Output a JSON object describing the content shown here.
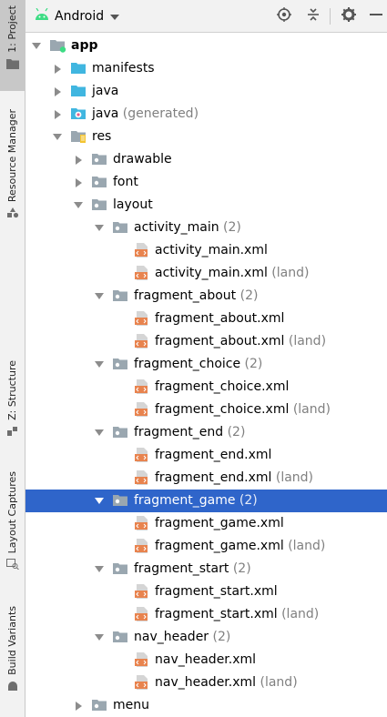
{
  "header": {
    "project_view": "Android",
    "tools": [
      "locate-icon",
      "collapse-all-icon",
      "gear-icon",
      "minimize-icon"
    ]
  },
  "sidebar": {
    "tabs": [
      {
        "label": "1: Project",
        "active": true
      },
      {
        "label": "Resource Manager",
        "active": false
      },
      {
        "label": "Z: Structure",
        "active": false
      },
      {
        "label": "Layout Captures",
        "active": false
      },
      {
        "label": "Build Variants",
        "active": false
      }
    ]
  },
  "tree": [
    {
      "depth": 0,
      "arrow": "down",
      "icon": "module",
      "label": "app",
      "hint": "",
      "bold": true
    },
    {
      "depth": 1,
      "arrow": "right",
      "icon": "folder-blue",
      "label": "manifests",
      "hint": ""
    },
    {
      "depth": 1,
      "arrow": "right",
      "icon": "folder-blue",
      "label": "java",
      "hint": ""
    },
    {
      "depth": 1,
      "arrow": "right",
      "icon": "folder-generated",
      "label": "java",
      "hint": " (generated)"
    },
    {
      "depth": 1,
      "arrow": "down",
      "icon": "folder-res",
      "label": "res",
      "hint": ""
    },
    {
      "depth": 2,
      "arrow": "right",
      "icon": "folder-gray",
      "label": "drawable",
      "hint": ""
    },
    {
      "depth": 2,
      "arrow": "right",
      "icon": "folder-gray",
      "label": "font",
      "hint": ""
    },
    {
      "depth": 2,
      "arrow": "down",
      "icon": "folder-gray",
      "label": "layout",
      "hint": ""
    },
    {
      "depth": 3,
      "arrow": "down",
      "icon": "folder-gray",
      "label": "activity_main",
      "hint": " (2)"
    },
    {
      "depth": 4,
      "arrow": "",
      "icon": "xml",
      "label": "activity_main.xml",
      "hint": ""
    },
    {
      "depth": 4,
      "arrow": "",
      "icon": "xml",
      "label": "activity_main.xml",
      "hint": " (land)"
    },
    {
      "depth": 3,
      "arrow": "down",
      "icon": "folder-gray",
      "label": "fragment_about",
      "hint": " (2)"
    },
    {
      "depth": 4,
      "arrow": "",
      "icon": "xml",
      "label": "fragment_about.xml",
      "hint": ""
    },
    {
      "depth": 4,
      "arrow": "",
      "icon": "xml",
      "label": "fragment_about.xml",
      "hint": " (land)"
    },
    {
      "depth": 3,
      "arrow": "down",
      "icon": "folder-gray",
      "label": "fragment_choice",
      "hint": " (2)"
    },
    {
      "depth": 4,
      "arrow": "",
      "icon": "xml",
      "label": "fragment_choice.xml",
      "hint": ""
    },
    {
      "depth": 4,
      "arrow": "",
      "icon": "xml",
      "label": "fragment_choice.xml",
      "hint": " (land)"
    },
    {
      "depth": 3,
      "arrow": "down",
      "icon": "folder-gray",
      "label": "fragment_end",
      "hint": " (2)"
    },
    {
      "depth": 4,
      "arrow": "",
      "icon": "xml",
      "label": "fragment_end.xml",
      "hint": ""
    },
    {
      "depth": 4,
      "arrow": "",
      "icon": "xml",
      "label": "fragment_end.xml",
      "hint": " (land)"
    },
    {
      "depth": 3,
      "arrow": "down",
      "icon": "folder-gray",
      "label": "fragment_game",
      "hint": " (2)",
      "selected": true
    },
    {
      "depth": 4,
      "arrow": "",
      "icon": "xml",
      "label": "fragment_game.xml",
      "hint": ""
    },
    {
      "depth": 4,
      "arrow": "",
      "icon": "xml",
      "label": "fragment_game.xml",
      "hint": " (land)"
    },
    {
      "depth": 3,
      "arrow": "down",
      "icon": "folder-gray",
      "label": "fragment_start",
      "hint": " (2)"
    },
    {
      "depth": 4,
      "arrow": "",
      "icon": "xml",
      "label": "fragment_start.xml",
      "hint": ""
    },
    {
      "depth": 4,
      "arrow": "",
      "icon": "xml",
      "label": "fragment_start.xml",
      "hint": " (land)"
    },
    {
      "depth": 3,
      "arrow": "down",
      "icon": "folder-gray",
      "label": "nav_header",
      "hint": " (2)"
    },
    {
      "depth": 4,
      "arrow": "",
      "icon": "xml",
      "label": "nav_header.xml",
      "hint": ""
    },
    {
      "depth": 4,
      "arrow": "",
      "icon": "xml",
      "label": "nav_header.xml",
      "hint": " (land)"
    },
    {
      "depth": 2,
      "arrow": "right",
      "icon": "folder-gray",
      "label": "menu",
      "hint": ""
    }
  ],
  "colors": {
    "selection": "#2f65ca",
    "folder_blue": "#40b6e0",
    "folder_gray": "#9aa7b0",
    "xml_orange": "#e8834e",
    "android_green": "#3ddc84"
  }
}
